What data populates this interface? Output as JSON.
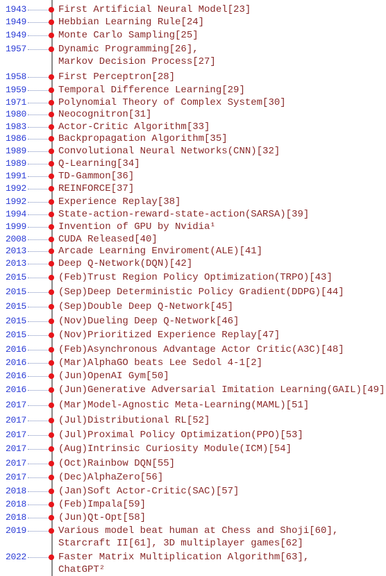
{
  "colors": {
    "year": "#2a3bd6",
    "event": "#8a2a2a",
    "marker": "#e8141a",
    "axis": "#8a8a8a"
  },
  "events": [
    {
      "year": "1943",
      "lines": [
        "First Artificial Neural Model[23]"
      ]
    },
    {
      "year": "1949",
      "lines": [
        "Hebbian Learning Rule[24]"
      ]
    },
    {
      "year": "1949",
      "lines": [
        "Monte Carlo Sampling[25]"
      ]
    },
    {
      "year": "1957",
      "lines": [
        "Dynamic Programming[26],",
        "Markov Decision Process[27]"
      ]
    },
    {
      "year": "1958",
      "lines": [
        "First Perceptron[28]"
      ]
    },
    {
      "year": "1959",
      "lines": [
        "Temporal Difference Learning[29]"
      ]
    },
    {
      "year": "1971",
      "lines": [
        "Polynomial Theory of Complex System[30]"
      ]
    },
    {
      "year": "1980",
      "lines": [
        "Neocognitron[31]"
      ]
    },
    {
      "year": "1983",
      "lines": [
        "Actor-Critic Algorithm[33]"
      ]
    },
    {
      "year": "1986",
      "lines": [
        "Backpropagation Algorithm[35]"
      ]
    },
    {
      "year": "1989",
      "lines": [
        "Convolutional Neural Networks(CNN)[32]"
      ]
    },
    {
      "year": "1989",
      "lines": [
        "Q-Learning[34]"
      ]
    },
    {
      "year": "1991",
      "lines": [
        "TD-Gammon[36]"
      ]
    },
    {
      "year": "1992",
      "lines": [
        "REINFORCE[37]"
      ]
    },
    {
      "year": "1992",
      "lines": [
        "Experience Replay[38]"
      ]
    },
    {
      "year": "1994",
      "lines": [
        "State-action-reward-state-action(SARSA)[39]"
      ]
    },
    {
      "year": "1999",
      "lines": [
        "Invention of GPU by Nvidia¹"
      ]
    },
    {
      "year": "2008",
      "lines": [
        "CUDA Released[40]"
      ]
    },
    {
      "year": "2013",
      "lines": [
        "Arcade Learning Enviroment(ALE)[41]"
      ]
    },
    {
      "year": "2013",
      "lines": [
        "Deep Q-Network(DQN)[42]"
      ]
    },
    {
      "year": "2015",
      "lines": [
        "(Feb)Trust Region Policy Optimization(TRPO)[43]"
      ]
    },
    {
      "year": "2015",
      "lines": [
        "(Sep)Deep Deterministic Policy Gradient(DDPG)[44]"
      ]
    },
    {
      "year": "2015",
      "lines": [
        "(Sep)Double Deep Q-Network[45]"
      ]
    },
    {
      "year": "2015",
      "lines": [
        "(Nov)Dueling Deep Q-Network[46]"
      ]
    },
    {
      "year": "2015",
      "lines": [
        "(Nov)Prioritized Experience Replay[47]"
      ]
    },
    {
      "year": "2016",
      "lines": [
        "(Feb)Asynchronous Advantage Actor Critic(A3C)[48]"
      ]
    },
    {
      "year": "2016",
      "lines": [
        "(Mar)AlphaGO beats Lee Sedol 4-1[2]"
      ]
    },
    {
      "year": "2016",
      "lines": [
        "(Jun)OpenAI Gym[50]"
      ]
    },
    {
      "year": "2016",
      "lines": [
        "(Jun)Generative Adversarial Imitation Learning(GAIL)[49]"
      ]
    },
    {
      "year": "2017",
      "lines": [
        "(Mar)Model-Agnostic Meta-Learning(MAML)[51]"
      ]
    },
    {
      "year": "2017",
      "lines": [
        "(Jul)Distributional RL[52]"
      ]
    },
    {
      "year": "2017",
      "lines": [
        "(Jul)Proximal Policy Optimization(PPO)[53]"
      ]
    },
    {
      "year": "2017",
      "lines": [
        "(Aug)Intrinsic Curiosity Module(ICM)[54]"
      ]
    },
    {
      "year": "2017",
      "lines": [
        "(Oct)Rainbow DQN[55]"
      ]
    },
    {
      "year": "2017",
      "lines": [
        "(Dec)AlphaZero[56]"
      ]
    },
    {
      "year": "2018",
      "lines": [
        "(Jan)Soft Actor-Critic(SAC)[57]"
      ]
    },
    {
      "year": "2018",
      "lines": [
        "(Feb)Impala[59]"
      ]
    },
    {
      "year": "2018",
      "lines": [
        "(Jun)Qt-Opt[58]"
      ]
    },
    {
      "year": "2019",
      "lines": [
        "Various model beat human at Chess and Shoji[60],",
        "Starcraft II[61], 3D multiplayer games[62]"
      ]
    },
    {
      "year": "2022",
      "lines": [
        "Faster Matrix Multiplication Algorithm[63],",
        "ChatGPT²"
      ]
    }
  ]
}
